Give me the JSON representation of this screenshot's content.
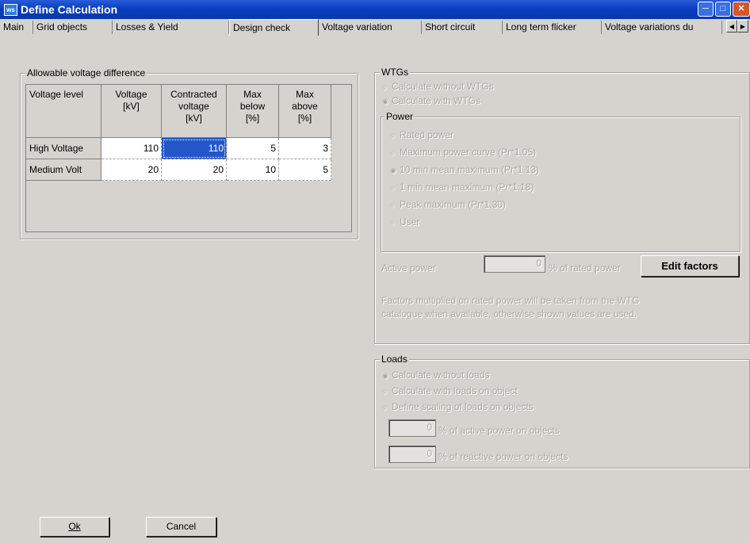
{
  "window": {
    "app_icon": "ws",
    "title": "Define Calculation",
    "controls": {
      "minimize": "minimize-icon",
      "maximize": "maximize-icon",
      "close": "close-icon"
    }
  },
  "tabs": [
    "Main",
    "Grid objects",
    "Losses & Yield",
    "Design check",
    "Voltage variation",
    "Short circuit",
    "Long term flicker",
    "Voltage variations du"
  ],
  "active_tab": "Design check",
  "voltage_group": {
    "legend": "Allowable voltage difference",
    "columns": {
      "level": "Voltage level",
      "voltage": [
        "Voltage",
        "[kV]"
      ],
      "contracted": [
        "Contracted",
        "voltage",
        "[kV]"
      ],
      "max_below": [
        "Max",
        "below",
        "[%]"
      ],
      "max_above": [
        "Max",
        "above",
        "[%]"
      ]
    },
    "rows": [
      {
        "level": "High Voltage",
        "voltage": "110",
        "contracted": "110",
        "max_below": "5",
        "max_above": "3"
      },
      {
        "level": "Medium Volt",
        "voltage": "20",
        "contracted": "20",
        "max_below": "10",
        "max_above": "5"
      }
    ]
  },
  "wtgs": {
    "legend": "WTGs",
    "options": [
      "Calculate without WTGs",
      "Calculate with WTGs"
    ],
    "selected": "Calculate with WTGs",
    "power": {
      "legend": "Power",
      "options": [
        "Rated power",
        "Maximum power curve (Pr*1.05)",
        "10 min mean maximum (Pr*1.13)",
        "1 min mean maximum (Pr*1.18)",
        "Peak maximum (Pr*1.30)",
        "User"
      ],
      "selected": "10 min mean maximum (Pr*1.13)"
    },
    "active_power_label": "Active power",
    "active_power_value": "0",
    "active_power_unit": "% of rated power",
    "edit_factors": "Edit factors",
    "note_line1": "Factors multiplied on rated power will be taken from the WTG",
    "note_line2": "catalogue when available, otherwise shown values are used."
  },
  "loads": {
    "legend": "Loads",
    "options": [
      "Calculate without loads",
      "Calculate with loads on object",
      "Define scaling of loads on objects"
    ],
    "selected": "Calculate without loads",
    "active_value": "0",
    "active_label": "% of active power on objects",
    "reactive_value": "0",
    "reactive_label": "% of reactive power on objects"
  },
  "buttons": {
    "ok": "Ok",
    "cancel": "Cancel"
  }
}
